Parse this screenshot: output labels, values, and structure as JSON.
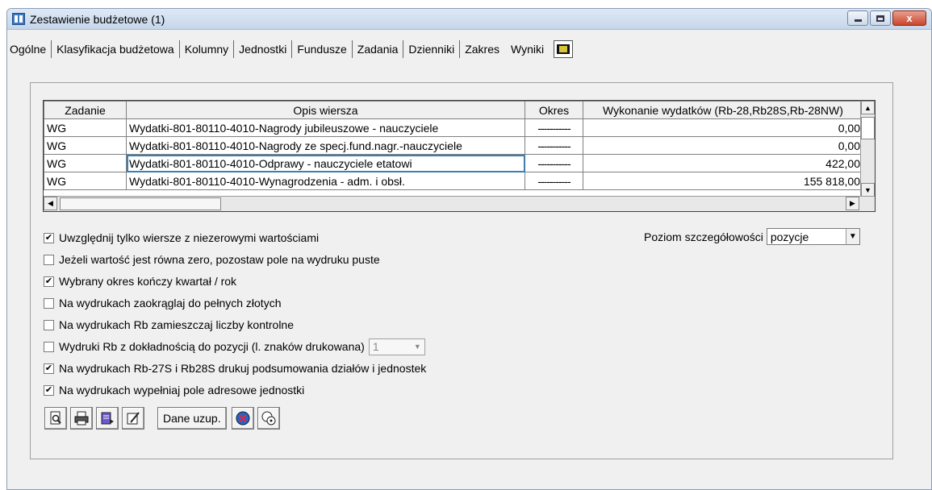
{
  "window": {
    "title": "Zestawienie budżetowe (1)",
    "close_glyph": "x"
  },
  "tabs": [
    "Ogólne",
    "Klasyfikacja budżetowa",
    "Kolumny",
    "Jednostki",
    "Fundusze",
    "Zadania",
    "Dzienniki",
    "Zakres",
    "Wyniki"
  ],
  "active_tab": "Wyniki",
  "grid": {
    "headers": [
      "Zadanie",
      "Opis wiersza",
      "Okres",
      "Wykonanie wydatków (Rb-28,Rb28S,Rb-28NW)"
    ],
    "rows": [
      {
        "zadanie": "WG",
        "opis": "Wydatki-801-80110-4010-Nagrody jubileuszowe - nauczyciele",
        "okres": "-----------",
        "wykonanie": "0,00"
      },
      {
        "zadanie": "WG",
        "opis": "Wydatki-801-80110-4010-Nagrody ze specj.fund.nagr.-nauczyciele",
        "okres": "-----------",
        "wykonanie": "0,00"
      },
      {
        "zadanie": "WG",
        "opis": "Wydatki-801-80110-4010-Odprawy - nauczyciele etatowi",
        "okres": "-----------",
        "wykonanie": "422,00"
      },
      {
        "zadanie": "WG",
        "opis": "Wydatki-801-80110-4010-Wynagrodzenia - adm. i obsł.",
        "okres": "-----------",
        "wykonanie": "155 818,00"
      }
    ]
  },
  "options": [
    {
      "label": "Uwzględnij tylko wiersze z niezerowymi wartościami",
      "checked": true
    },
    {
      "label": "Jeżeli wartość jest równa zero, pozostaw pole na wydruku puste",
      "checked": false
    },
    {
      "label": "Wybrany okres kończy kwartał / rok",
      "checked": true
    },
    {
      "label": "Na wydrukach zaokrąglaj do pełnych złotych",
      "checked": false
    },
    {
      "label": "Na wydrukach Rb zamieszczaj liczby kontrolne",
      "checked": false
    },
    {
      "label": "Wydruki Rb z dokładnością do pozycji (l. znaków drukowana)",
      "checked": false,
      "combo_value": "1"
    },
    {
      "label": "Na wydrukach Rb-27S i Rb28S drukuj podsumowania działów i jednostek",
      "checked": true
    },
    {
      "label": "Na wydrukach wypełniaj pole adresowe jednostki",
      "checked": true
    }
  ],
  "poziom": {
    "label": "Poziom szczegółowości",
    "value": "pozycje"
  },
  "toolbar": {
    "dane_label": "Dane uzup."
  },
  "icons": [
    "app-icon",
    "preview-icon",
    "print-icon",
    "export-icon",
    "edit-icon",
    "help-icon",
    "settings-icon",
    "film-icon"
  ],
  "colors": {
    "selection_border": "#3c7fb1",
    "close_button": "#c9452b"
  }
}
